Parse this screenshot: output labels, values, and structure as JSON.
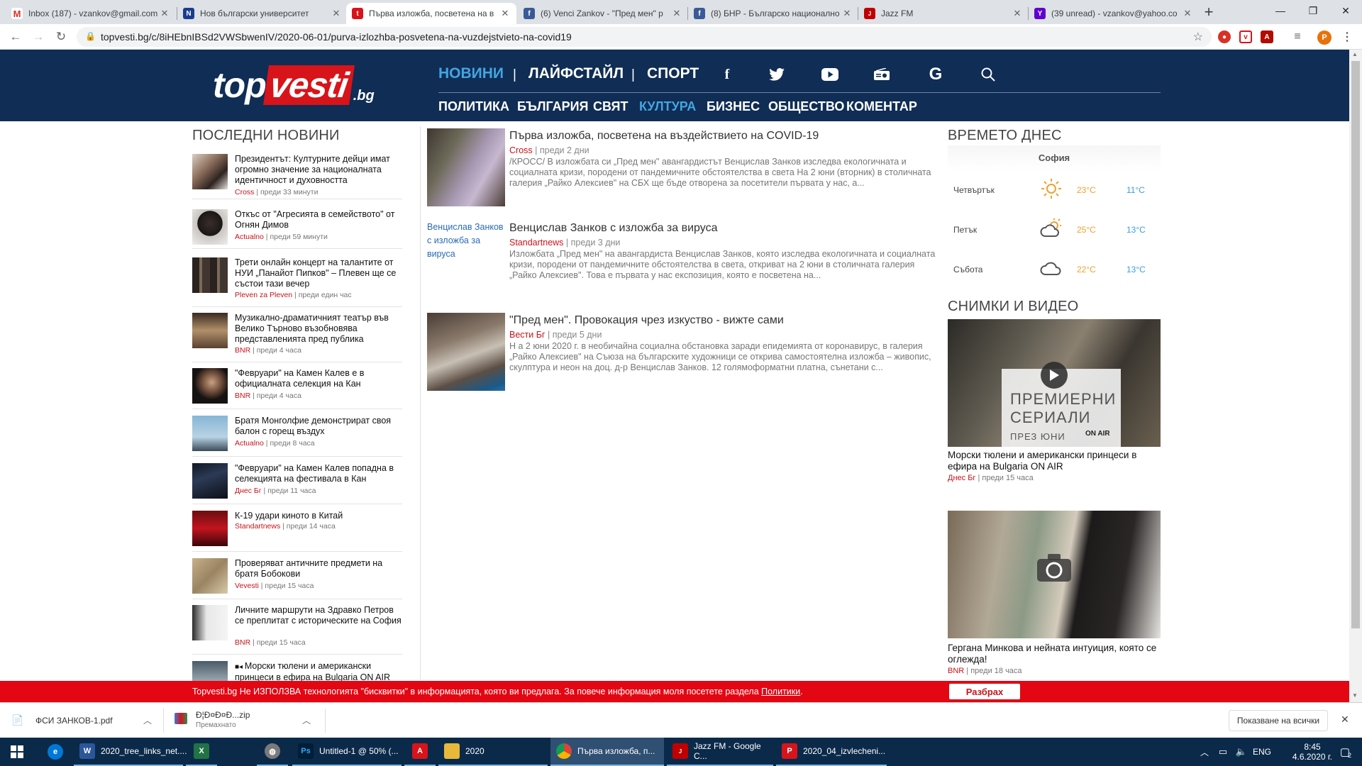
{
  "browser": {
    "tabs": [
      {
        "title": "Inbox (187) - vzankov@gmail.com",
        "icon": "gmail-icon",
        "color": "#d93025"
      },
      {
        "title": "Нов български университет",
        "icon": "nbu-icon",
        "color": "#1a3d8f"
      },
      {
        "title": "Първа изложба, посветена на в",
        "icon": "topvesti-icon",
        "color": "#d7141a"
      },
      {
        "title": "(6) Venci Zankov - \"Пред мен\" р",
        "icon": "facebook-icon",
        "color": "#3b5998"
      },
      {
        "title": "(8) БНР - Българско национално",
        "icon": "facebook-icon",
        "color": "#3b5998"
      },
      {
        "title": "Jazz FM",
        "icon": "jazzfm-icon",
        "color": "#c00000"
      },
      {
        "title": "(39 unread) - vzankov@yahoo.co",
        "icon": "yahoo-icon",
        "color": "#6001d2"
      }
    ],
    "new_tab": "+",
    "url": "topvesti.bg/c/8iHEbnIBSd2VWSbwenIV/2020-06-01/purva-izlozhba-posvetena-na-vuzdejstvieto-na-covid19",
    "profile_initial": "P"
  },
  "site": {
    "logo": {
      "top": "top",
      "vesti": "vesti",
      "bg": ".bg"
    },
    "main_nav": [
      "НОВИНИ",
      "ЛАЙФСТАЙЛ",
      "СПОРТ"
    ],
    "sub_nav": [
      "ПОЛИТИКА",
      "БЪЛГАРИЯ",
      "СВЯТ",
      "КУЛТУРА",
      "БИЗНЕС",
      "ОБЩЕСТВО",
      "КОМЕНТАР"
    ],
    "colors": {
      "header": "#0f2d55",
      "accent": "#43a5e0",
      "brand_red": "#d7141a"
    }
  },
  "latest": {
    "title": "ПОСЛЕДНИ НОВИНИ",
    "items": [
      {
        "text": "Президентът: Културните дейци имат огромно значение за националната идентичност и духовността",
        "source": "Cross",
        "time": "преди 33 минути"
      },
      {
        "text": "Откъс от \"Агресията в семейството\" от Огнян Димов",
        "source": "Actualno",
        "time": "преди 59 минути"
      },
      {
        "text": "Трети онлайн концерт на талантите от НУИ „Панайот Пипков\" – Плевен ще се състои тази вечер",
        "source": "Pleven za Pleven",
        "time": "преди един час"
      },
      {
        "text": "Музикално-драматичният театър във Велико Търново възобновява представленията пред публика",
        "source": "BNR",
        "time": "преди 4 часа"
      },
      {
        "text": "\"Февруари\" на Камен Калев е в официалната селекция на Кан",
        "source": "BNR",
        "time": "преди 4 часа"
      },
      {
        "text": "Братя Монголфие демонстрират своя балон с горещ въздух",
        "source": "Actualno",
        "time": "преди 8 часа"
      },
      {
        "text": "\"Февруари\" на Камен Калев попадна в селекцията на фестивала в Кан",
        "source": "Днес Бг",
        "time": "преди 11 часа"
      },
      {
        "text": "К-19 удари киното в Китай",
        "source": "Standartnews",
        "time": "преди 14 часа"
      },
      {
        "text": "Проверяват античните предмети на братя Бобокови",
        "source": "Vevesti",
        "time": "преди 15 часа"
      },
      {
        "text": "Личните маршрути на Здравко Петров се преплитат с историческите на София",
        "source": "BNR",
        "time": "преди 15 часа"
      },
      {
        "text": "Морски тюлени и американски принцеси в ефира на Bulgaria ON AIR",
        "source": "",
        "time": ""
      }
    ]
  },
  "stories": [
    {
      "title": "Първа изложба, посветена на въздействието на COVID-19",
      "source": "Cross",
      "time": "преди 2 дни",
      "text": "/КРОСС/ В изложбата си „Пред мен\" авангардистът Венцислав Занков изследва екологичната и социалната кризи, породени от пандемичните обстоятелства в света На 2 юни (вторник) в столичната галерия „Райко Алексиев\" на СБХ ще бъде отворена за посетители първата у нас, а..."
    },
    {
      "title": "Венцислав Занков с изложба за вируса",
      "source": "Standartnews",
      "time": "преди 3 дни",
      "alt": "Венцислав Занков с изложба за вируса",
      "text": "Изложбата „Пред мен\" на авангардиста  Венцислав Занков, която изследва екологичната и социалната кризи, породени от пандемичните обстоятелства в света, откриват  на 2 юни в столичната галерия „Райко Алексиев\". Това е първата у нас експозиция, която е посветена на..."
    },
    {
      "title": "\"Пред мен\". Провокация чрез изкуство - вижте сами",
      "source": "Вести Бг",
      "time": "преди 5 дни",
      "text": "Н а 2 юни 2020 г. в необичайна социална обстановка заради епидемията от коронавирус, в галерия „Райко Алексиев\" на Съюза на българските художници се открива самостоятелна изложба – живопис, скулптура и неон на доц. д-р Венцислав Занков. 12 голямоформатни платна, сънетани с..."
    }
  ],
  "weather": {
    "title": "ВРЕМЕТО ДНЕС",
    "city": "София",
    "days": [
      {
        "day": "Четвъртък",
        "icon": "sun-icon",
        "hi": "23°C",
        "lo": "11°C"
      },
      {
        "day": "Петък",
        "icon": "sun-cloud-icon",
        "hi": "25°C",
        "lo": "13°C"
      },
      {
        "day": "Събота",
        "icon": "cloud-icon",
        "hi": "22°C",
        "lo": "13°C"
      }
    ]
  },
  "media": {
    "title": "СНИМКИ И ВИДЕО",
    "items": [
      {
        "caption": "Морски тюлени и американски принцеси в ефира на Bulgaria ON AIR",
        "source": "Днес Бг",
        "time": "преди 15 часа",
        "overlay_line1": "ПРЕМИЕРНИ",
        "overlay_line2": "СЕРИАЛИ",
        "overlay_line3": "ПРЕЗ ЮНИ",
        "overlay_brand": "ON AIR"
      },
      {
        "caption": "Гергана Минкова и нейната интуиция, която се оглежда!",
        "source": "BNR",
        "time": "преди 18 часа"
      }
    ]
  },
  "cookie": {
    "text": "Topvesti.bg Не ИЗПОЛЗВА технологията \"бисквитки\" в информацията, която ви предлага. За повече информация моля посетете раздела ",
    "link": "Политики",
    "end": ".",
    "button": "Разбрах"
  },
  "downloads": {
    "items": [
      {
        "name": "ФСИ ЗАНКОВ-1.pdf",
        "status": ""
      },
      {
        "name": "Ð¦Ð¤Ð¤Ð...zip",
        "status": "Премахнато"
      }
    ],
    "show_all": "Показване на всички"
  },
  "taskbar": {
    "apps": [
      {
        "label": "2020_tree_links_net....",
        "icon": "word-icon",
        "color": "#2b579a"
      },
      {
        "label": "",
        "icon": "excel-icon",
        "color": "#217346"
      },
      {
        "label": "",
        "icon": "globe-icon",
        "color": "#7a7a7a"
      },
      {
        "label": "Untitled-1 @ 50% (...",
        "icon": "photoshop-icon",
        "color": "#001e36"
      },
      {
        "label": "",
        "icon": "acrobat-icon",
        "color": "#d7141a"
      },
      {
        "label": "2020",
        "icon": "folder-icon",
        "color": "#e8b83a"
      },
      {
        "label": "Първа изложба, п...",
        "icon": "chrome-icon",
        "color": "#4285f4"
      },
      {
        "label": "Jazz FM - Google C...",
        "icon": "jazzfm-icon",
        "color": "#c00000"
      },
      {
        "label": "2020_04_izvlecheni...",
        "icon": "pdf-icon",
        "color": "#d7141a"
      }
    ],
    "lang": "ENG",
    "time": "8:45",
    "date": "4.6.2020 г.",
    "notif_count": "2"
  }
}
